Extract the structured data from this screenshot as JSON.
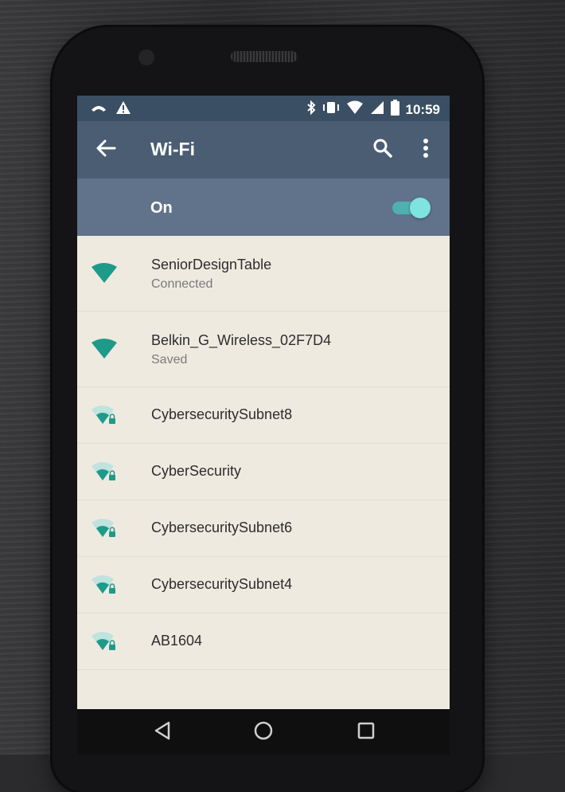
{
  "status_bar": {
    "time": "10:59",
    "left_icons": [
      "missed-call-icon",
      "warning-icon"
    ],
    "right_icons": [
      "bluetooth-icon",
      "vibrate-icon",
      "wifi-signal-icon",
      "cell-signal-icon",
      "battery-icon"
    ]
  },
  "app_bar": {
    "title": "Wi-Fi",
    "back_icon": "arrow-back-icon",
    "search_icon": "search-icon",
    "more_icon": "more-vert-icon"
  },
  "wifi_switch": {
    "label": "On",
    "state": "on"
  },
  "networks": [
    {
      "ssid": "SeniorDesignTable",
      "status": "Connected",
      "secured": false
    },
    {
      "ssid": "Belkin_G_Wireless_02F7D4",
      "status": "Saved",
      "secured": false
    },
    {
      "ssid": "CybersecuritySubnet8",
      "status": "",
      "secured": true
    },
    {
      "ssid": "CyberSecurity",
      "status": "",
      "secured": true
    },
    {
      "ssid": "CybersecuritySubnet6",
      "status": "",
      "secured": true
    },
    {
      "ssid": "CybersecuritySubnet4",
      "status": "",
      "secured": true
    },
    {
      "ssid": "AB1604",
      "status": "",
      "secured": true
    }
  ],
  "nav_bar": {
    "back": "nav-back-icon",
    "home": "nav-home-icon",
    "recents": "nav-recents-icon"
  },
  "colors": {
    "status_bar": "#3b4f64",
    "app_bar": "#4a5d73",
    "switch_bar": "#60738a",
    "accent": "#1e9a8a",
    "list_bg": "#efeae0"
  }
}
